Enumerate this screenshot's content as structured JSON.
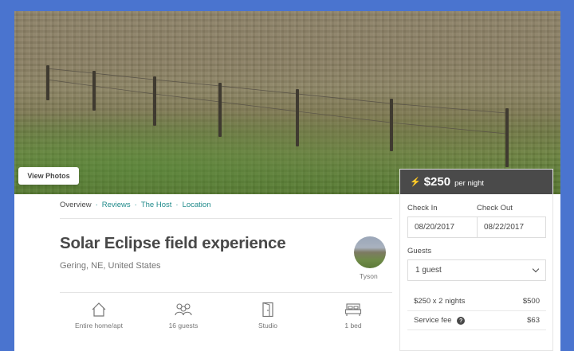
{
  "hero": {
    "view_photos_label": "View Photos"
  },
  "booking": {
    "price": "$250",
    "per_night": "per night",
    "check_in_label": "Check In",
    "check_out_label": "Check Out",
    "check_in_value": "08/20/2017",
    "check_out_value": "08/22/2017",
    "guests_label": "Guests",
    "guests_value": "1 guest",
    "nights_line": "$250 x 2 nights",
    "nights_amount": "$500",
    "service_fee_label": "Service fee",
    "service_fee_amount": "$63",
    "icons": {
      "price_icon": "lightning-bolt",
      "help_icon": "question-circle",
      "dropdown_icon": "chevron-down"
    },
    "colors": {
      "price_bar": "#4a4a4a",
      "bolt": "#f6b93b"
    }
  },
  "nav": {
    "tabs": [
      {
        "label": "Overview",
        "active": true
      },
      {
        "label": "Reviews",
        "active": false
      },
      {
        "label": "The Host",
        "active": false
      },
      {
        "label": "Location",
        "active": false
      }
    ],
    "separator": "·",
    "colors": {
      "link": "#1f8a8a"
    }
  },
  "listing": {
    "title": "Solar Eclipse field experience",
    "location": "Gering, NE, United States",
    "host_name": "Tyson"
  },
  "amenities": [
    {
      "icon": "home-icon",
      "label": "Entire home/apt"
    },
    {
      "icon": "guests-icon",
      "label": "16 guests"
    },
    {
      "icon": "door-icon",
      "label": "Studio"
    },
    {
      "icon": "bed-icon",
      "label": "1 bed"
    }
  ]
}
